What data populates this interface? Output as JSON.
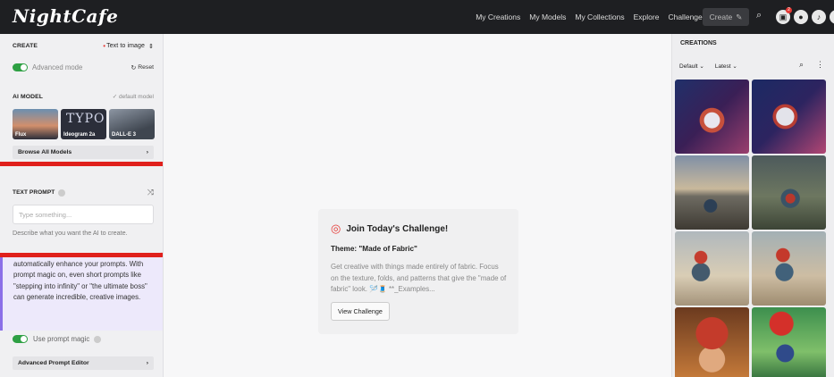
{
  "app": {
    "logo": "NightCafe"
  },
  "nav": {
    "items": [
      "My Creations",
      "My Models",
      "My Collections",
      "Explore",
      "Challenges"
    ],
    "create_label": "Create",
    "notification_count": "2"
  },
  "left": {
    "create_label": "CREATE",
    "mode_select": "Text to image",
    "advanced_mode": "Advanced mode",
    "reset": "Reset",
    "ai_model_label": "AI MODEL",
    "default_model": "default model",
    "models": [
      "Flux",
      "Ideogram 2a",
      "DALL-E 3"
    ],
    "model_art_text": "TYPO",
    "browse_models": "Browse All Models",
    "text_prompt_label": "TEXT PROMPT",
    "prompt_placeholder": "Type something...",
    "prompt_help": "Describe what you want the AI to create.",
    "magic_text": "automatically enhance your prompts. With prompt magic on, even short prompts like \"stepping into infinity\" or \"the ultimate boss\" can generate incredible, creative images.",
    "use_prompt_magic": "Use prompt magic",
    "advanced_prompt_editor": "Advanced Prompt Editor"
  },
  "challenge": {
    "title": "Join Today's Challenge!",
    "theme": "Theme: \"Made of Fabric\"",
    "description": "Get creative with things made entirely of fabric. Focus on the texture, folds, and patterns that give the \"made of fabric\" look. 🪡🧵 **_Examples...",
    "button": "View Challenge"
  },
  "right": {
    "title": "CREATIONS",
    "filter1": "Default",
    "filter2": "Latest"
  },
  "colors": {
    "topbar": "#1e1f22",
    "toggle": "#2ea043",
    "annotation_red": "#e0201c",
    "magic_bg": "#ede9fb"
  }
}
